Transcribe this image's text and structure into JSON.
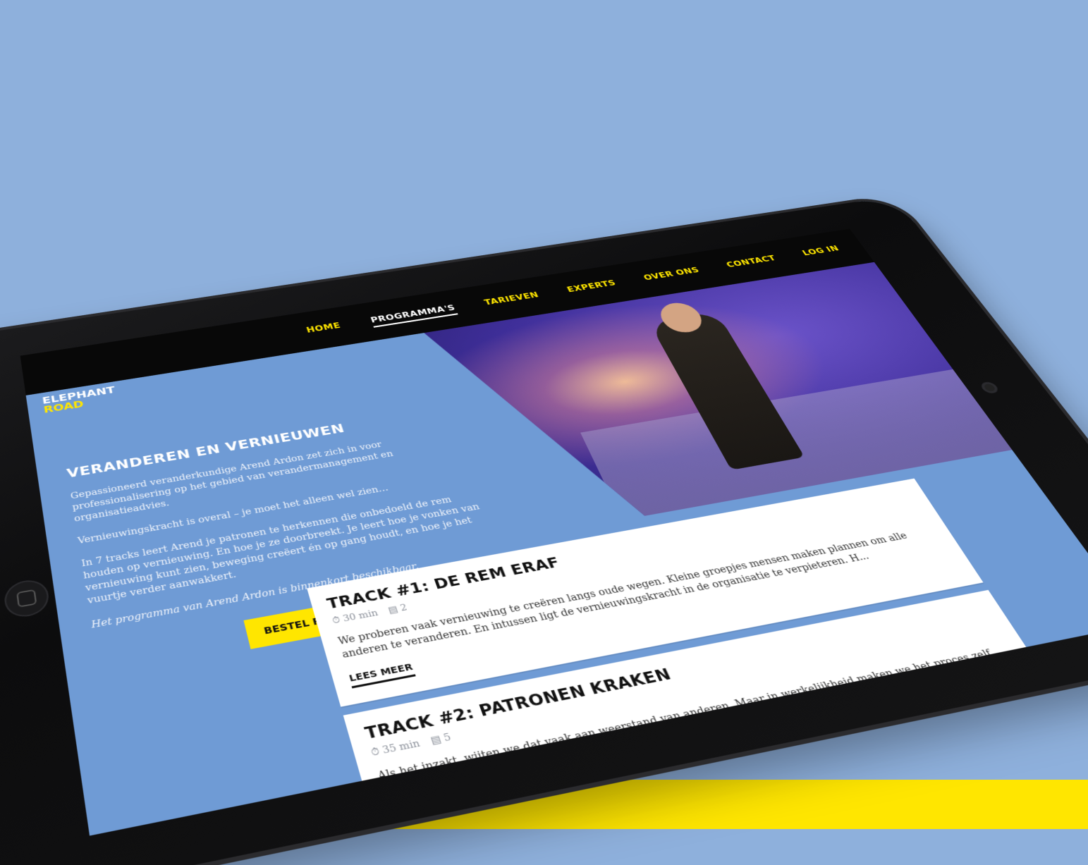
{
  "brand": {
    "logo_line1": "ELEPHANT",
    "logo_line2": "ROAD"
  },
  "nav": {
    "items": [
      {
        "label": "HOME",
        "active": false
      },
      {
        "label": "PROGRAMMA'S",
        "active": true
      },
      {
        "label": "TARIEVEN",
        "active": false
      },
      {
        "label": "EXPERTS",
        "active": false
      },
      {
        "label": "OVER ONS",
        "active": false
      },
      {
        "label": "CONTACT",
        "active": false
      },
      {
        "label": "LOG IN",
        "active": false
      }
    ]
  },
  "intro": {
    "title": "VERANDEREN EN VERNIEUWEN",
    "p1": "Gepassioneerd veranderkundige Arend Ardon zet zich in voor professionalisering op het gebied van verandermanagement en organisatieadvies.",
    "p2": "Vernieuwingskracht is overal – je moet het alleen wel zien…",
    "p3": "In 7 tracks leert Arend je patronen te herkennen die onbedoeld de rem houden op vernieuwing. En hoe je ze doorbreekt. Je leert hoe je vonken van vernieuwing kunt zien, beweging creëert én op gang houdt, en hoe je het vuurtje verder aanwakkert.",
    "p4": "Het programma van Arend Ardon is binnenkort beschikbaar.",
    "cta": "BESTEL PROGRAMMA"
  },
  "tracks": [
    {
      "title": "TRACK #1: DE REM ERAF",
      "duration": "30 min",
      "count": "2",
      "text": "We proberen vaak vernieuwing te creëren langs oude wegen. Kleine groepjes mensen maken plannen om alle anderen te veranderen. En intussen ligt de vernieuwingskracht in de organisatie te verpieteren. H...",
      "more": "LEES MEER"
    },
    {
      "title": "TRACK #2: PATRONEN KRAKEN",
      "duration": "35 min",
      "count": "5",
      "text": "Als het inzakt, wijten we dat vaak aan weerstand van anderen. Maar in werkelijkheid maken we het proces zelf stroperig met ingesleten gedragspatronen. Leer hoe je die patronen blootlegt en doorbreekt....",
      "more": ""
    }
  ],
  "colors": {
    "background": "#8eb0dc",
    "accent": "#ffe600",
    "screen_bg": "#6f9bd5",
    "nav_bg": "#080808"
  },
  "icons": {
    "duration": "clock-icon",
    "count": "document-icon"
  }
}
